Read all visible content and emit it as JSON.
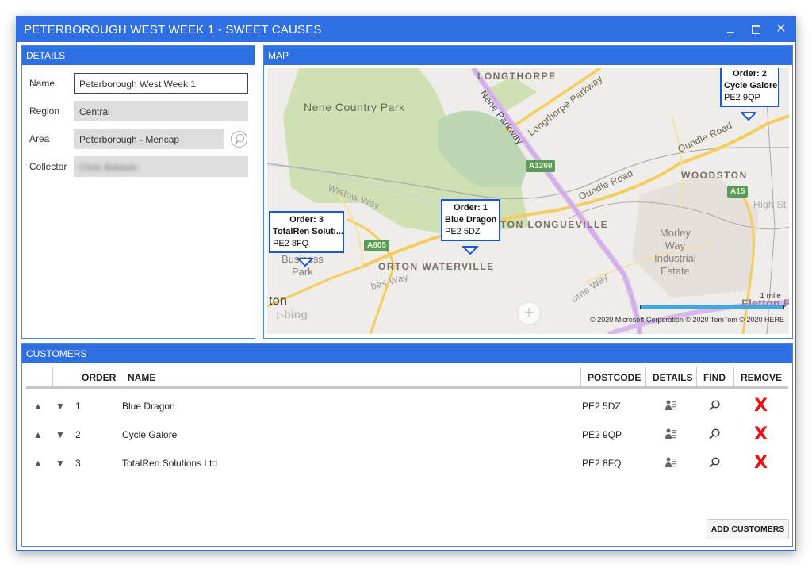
{
  "window": {
    "title": "PETERBOROUGH WEST WEEK 1 - SWEET CAUSES",
    "controls": {
      "minimize": "minimize",
      "maximize": "maximize",
      "close": "✕"
    }
  },
  "details": {
    "header": "DETAILS",
    "fields": [
      {
        "label": "Name",
        "value": "Peterborough West Week 1",
        "editable": true
      },
      {
        "label": "Region",
        "value": "Central",
        "editable": false
      },
      {
        "label": "Area",
        "value": "Peterborough - Mencap",
        "editable": false
      },
      {
        "label": "Collector",
        "value": "Chris Baldwin",
        "editable": false,
        "blurred": true
      }
    ]
  },
  "map": {
    "header": "MAP",
    "labels": {
      "longthorpe": "LONGTHORPE",
      "nene_park": "Nene Country Park",
      "nene_parkway": "Nene Parkway",
      "longthorpe_parkway": "Longthorpe Parkway",
      "oundle_road_1": "Oundle Road",
      "oundle_road_2": "Oundle Road",
      "woodston": "WOODSTON",
      "high_st": "High St",
      "orton_longueville": "TON LONGUEVILLE",
      "orton_waterville": "ORTON WATERVILLE",
      "morley_way": "Morley\nWay\nIndustrial\nEstate",
      "business_park": "Business\nPark",
      "wistow_way": "Wistow Way",
      "bes_way": "bes Way",
      "orne_way": "orne Way",
      "ton": "ton",
      "fletton_park": "Fletton Park",
      "a1260": "A1260",
      "a605": "A605",
      "a15": "A15"
    },
    "markers": [
      {
        "order": "Order: 1",
        "name": "Blue Dragon",
        "postcode": "PE2 5DZ"
      },
      {
        "order": "Order: 2",
        "name": "Cycle Galore",
        "postcode": "PE2 9QP"
      },
      {
        "order": "Order: 3",
        "name": "TotalRen Soluti...",
        "postcode": "PE2 8FQ"
      }
    ],
    "scale": "1 mile",
    "copyright": "© 2020 Microsoft Corporation   © 2020 TomTom © 2020 HERE",
    "logo": "bing",
    "zoom_button": "+"
  },
  "customers": {
    "header": "CUSTOMERS",
    "columns": [
      "",
      "",
      "ORDER",
      "NAME",
      "POSTCODE",
      "DETAILS",
      "FIND",
      "REMOVE"
    ],
    "rows": [
      {
        "order": "1",
        "name": "Blue Dragon",
        "postcode": "PE2 5DZ"
      },
      {
        "order": "2",
        "name": "Cycle Galore",
        "postcode": "PE2 9QP"
      },
      {
        "order": "3",
        "name": "TotalRen Solutions Ltd",
        "postcode": "PE2 8FQ"
      }
    ],
    "move_up": "▲",
    "move_down": "▼",
    "remove_glyph": "X",
    "add_button": "ADD CUSTOMERS"
  },
  "colors": {
    "accent": "#2f6fe4",
    "remove": "#ee1111",
    "marker_border": "#1a56d8"
  }
}
